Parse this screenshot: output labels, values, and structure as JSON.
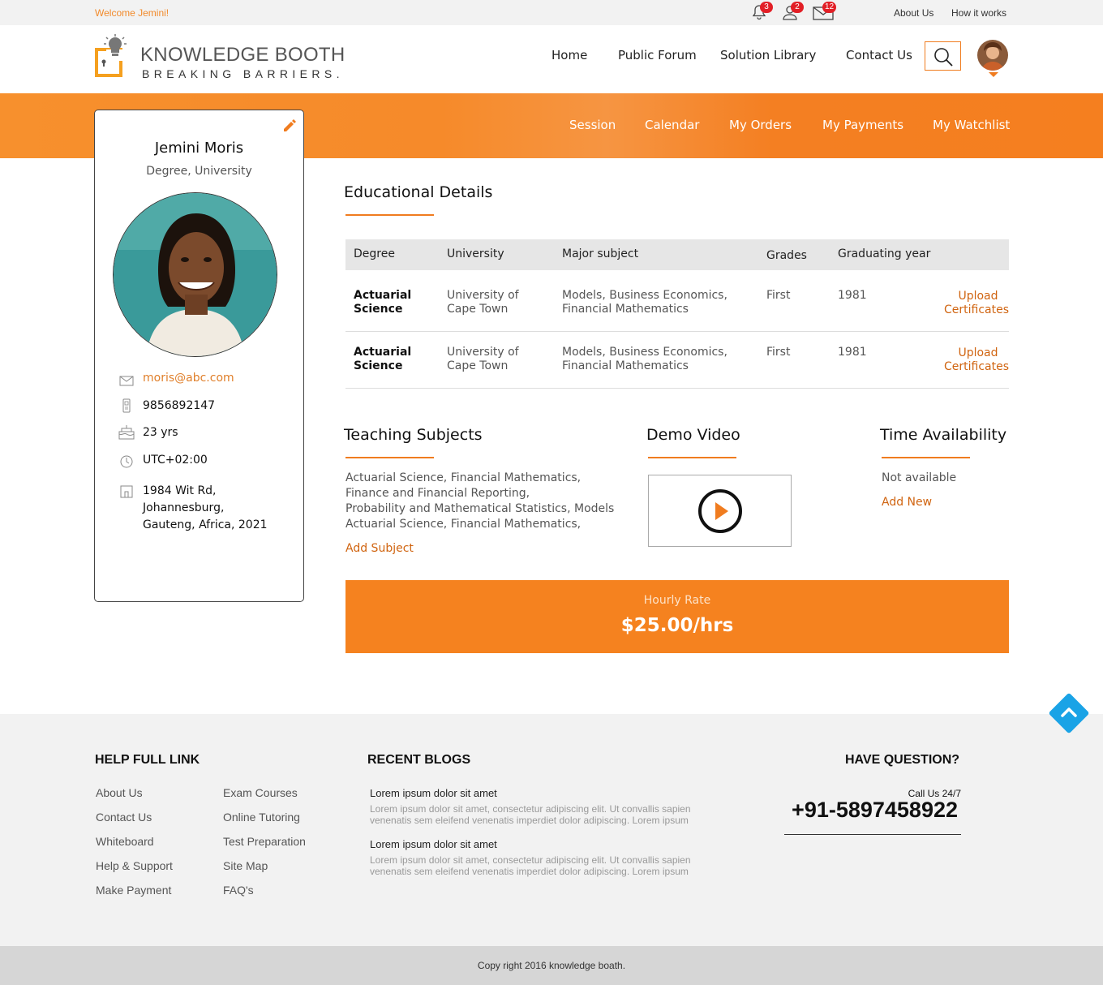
{
  "topbar": {
    "welcome": "Welcome Jemini!",
    "notifications": "3",
    "friend_requests": "2",
    "messages": "12",
    "about_link": "About Us",
    "how_link": "How it works"
  },
  "brand": {
    "title": "KNOWLEDGE BOOTH",
    "tagline": "BREAKING BARRIERS."
  },
  "nav": {
    "items": [
      "Home",
      "Public Forum",
      "Solution Library",
      "Contact Us"
    ]
  },
  "subnav": {
    "items": [
      "Session",
      "Calendar",
      "My Orders",
      "My Payments",
      "My Watchlist"
    ]
  },
  "profile": {
    "name": "Jemini Moris",
    "degree": "Degree, University",
    "email": "moris@abc.com",
    "phone": "9856892147",
    "age": "23 yrs",
    "timezone": "UTC+02:00",
    "address": [
      "1984 Wit Rd,",
      "Johannesburg,",
      "Gauteng, Africa, 2021"
    ]
  },
  "education": {
    "title": "Educational Details",
    "headers": [
      "Degree",
      "University",
      "Major subject",
      "Grades",
      "Graduating year"
    ],
    "rows": [
      {
        "degree": [
          "Actuarial",
          "Science"
        ],
        "university": [
          "University of",
          "Cape Town"
        ],
        "major": [
          "Models, Business Economics,",
          "Financial Mathematics"
        ],
        "grade": "First",
        "year": "1981",
        "action": [
          "Upload",
          "Certificates"
        ]
      },
      {
        "degree": [
          "Actuarial",
          "Science"
        ],
        "university": [
          "University of",
          "Cape Town"
        ],
        "major": [
          "Models, Business Economics,",
          "Financial Mathematics"
        ],
        "grade": "First",
        "year": "1981",
        "action": [
          "Upload",
          "Certificates"
        ]
      }
    ]
  },
  "teaching": {
    "title": "Teaching Subjects",
    "lines": [
      "Actuarial Science, Financial Mathematics,",
      "Finance and Financial Reporting,",
      "Probability and Mathematical Statistics, Models",
      "Actuarial Science, Financial Mathematics,"
    ],
    "add": "Add Subject"
  },
  "demo": {
    "title": "Demo Video"
  },
  "availability": {
    "title": "Time Availability",
    "status": "Not available",
    "add": "Add New"
  },
  "rate": {
    "label": "Hourly Rate",
    "value": "$25.00/hrs"
  },
  "footer": {
    "help_title": "HELP FULL LINK",
    "links_col1": [
      "About Us",
      "Contact Us",
      "Whiteboard",
      "Help & Support",
      "Make Payment"
    ],
    "links_col2": [
      "Exam Courses",
      "Online Tutoring",
      "Test Preparation",
      "Site Map",
      "FAQ's"
    ],
    "blogs_title": "RECENT BLOGS",
    "blogs": [
      {
        "title": "Lorem ipsum dolor sit amet",
        "text": "Lorem ipsum dolor sit amet, consectetur adipiscing elit. Ut convallis sapien venenatis sem eleifend venenatis imperdiet dolor adipiscing. Lorem ipsum"
      },
      {
        "title": "Lorem ipsum dolor sit amet",
        "text": "Lorem ipsum dolor sit amet, consectetur adipiscing elit. Ut convallis sapien venenatis sem eleifend venenatis imperdiet dolor adipiscing. Lorem ipsum"
      }
    ],
    "question_title": "HAVE QUESTION?",
    "call_label": "Call Us 24/7",
    "phone": "+91-5897458922",
    "copyright": "Copy right 2016  knowledge boath."
  },
  "colors": {
    "accent": "#f07c1f",
    "link": "#d06410",
    "scroll_top": "#1aa3e6"
  }
}
